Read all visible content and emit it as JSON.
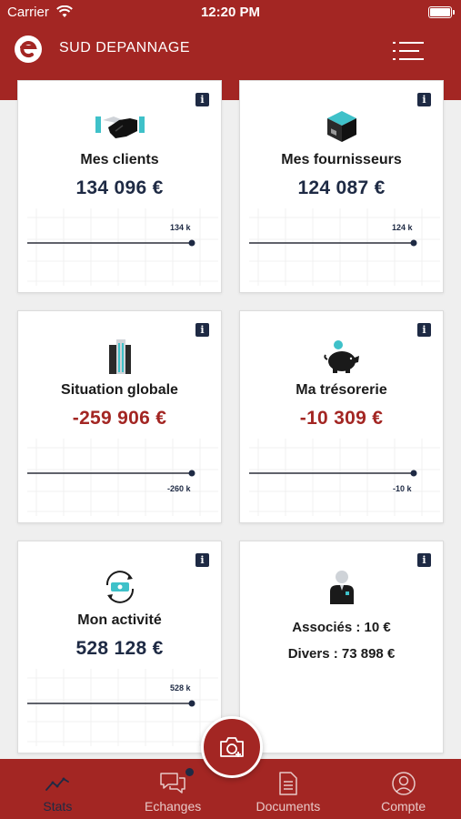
{
  "status_bar": {
    "carrier": "Carrier",
    "time": "12:20 PM"
  },
  "header": {
    "title": "SUD DEPANNAGE"
  },
  "cards": {
    "clients": {
      "label": "Mes clients",
      "value": "134 096 €",
      "chart_label": "134 k"
    },
    "fournisseurs": {
      "label": "Mes fournisseurs",
      "value": "124 087 €",
      "chart_label": "124 k"
    },
    "situation": {
      "label": "Situation globale",
      "value": "-259 906 €",
      "chart_label": "-260 k"
    },
    "tresorerie": {
      "label": "Ma trésorerie",
      "value": "-10 309 €",
      "chart_label": "-10 k"
    },
    "activite": {
      "label": "Mon activité",
      "value": "528 128 €",
      "chart_label": "528 k"
    },
    "associes": {
      "associes": "Associés :  10 €",
      "divers": "Divers :  73 898 €"
    }
  },
  "info_icon": "i",
  "tabs": [
    {
      "label": "Stats",
      "icon": "chart-icon",
      "active": true
    },
    {
      "label": "Echanges",
      "icon": "chat-icon",
      "badge": true
    },
    {
      "label": "Documents",
      "icon": "document-icon"
    },
    {
      "label": "Compte",
      "icon": "account-icon"
    }
  ],
  "colors": {
    "brand_red": "#a32623",
    "navy": "#1e2a44",
    "teal": "#3fc1c9",
    "background": "#efefef"
  }
}
